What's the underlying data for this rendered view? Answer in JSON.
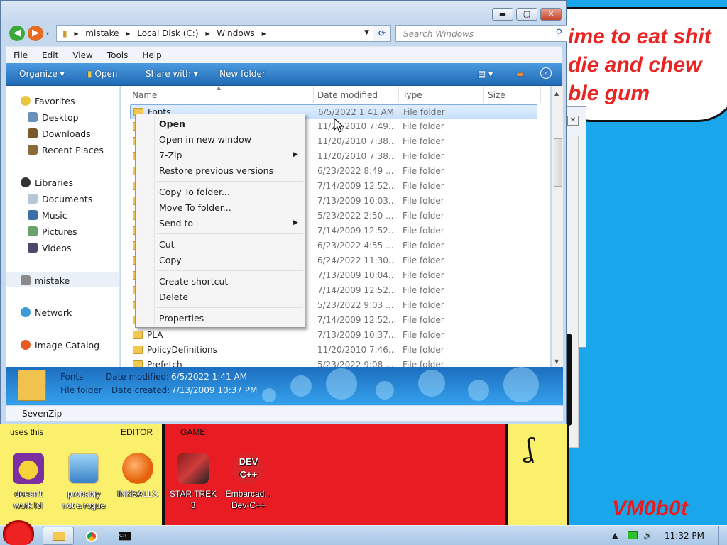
{
  "wallpaper": {
    "line1": "ime to eat shit",
    "line2": "die and chew",
    "line3": "ble gum",
    "label_uses": "uses this",
    "label_editor": "EDITOR",
    "label_game": "GAME",
    "signature": "VM0b0t"
  },
  "window": {
    "address": [
      "mistake",
      "Local Disk (C:)",
      "Windows"
    ],
    "search_placeholder": "Search Windows",
    "menu": [
      "File",
      "Edit",
      "View",
      "Tools",
      "Help"
    ],
    "toolbar": {
      "organize": "Organize",
      "open": "Open",
      "share_with": "Share with",
      "new_folder": "New folder"
    },
    "nav": {
      "favorites": "Favorites",
      "desktop": "Desktop",
      "downloads": "Downloads",
      "recent_places": "Recent Places",
      "libraries": "Libraries",
      "documents": "Documents",
      "music": "Music",
      "pictures": "Pictures",
      "videos": "Videos",
      "mistake": "mistake",
      "network": "Network",
      "image_catalog": "Image Catalog"
    },
    "columns": {
      "name": "Name",
      "date_modified": "Date modified",
      "type": "Type",
      "size": "Size"
    },
    "rows": [
      {
        "name": "Fonts",
        "date": "6/5/2022 1:41 AM",
        "type": "File folder"
      },
      {
        "name": "",
        "date": "11/20/2010 7:49...",
        "type": "File folder"
      },
      {
        "name": "",
        "date": "11/20/2010 7:38...",
        "type": "File folder"
      },
      {
        "name": "",
        "date": "11/20/2010 7:38...",
        "type": "File folder"
      },
      {
        "name": "",
        "date": "6/23/2022 8:49 ...",
        "type": "File folder"
      },
      {
        "name": "",
        "date": "7/14/2009 12:52...",
        "type": "File folder"
      },
      {
        "name": "",
        "date": "7/13/2009 10:03...",
        "type": "File folder"
      },
      {
        "name": "",
        "date": "5/23/2022 2:50 ...",
        "type": "File folder"
      },
      {
        "name": "",
        "date": "7/14/2009 12:52...",
        "type": "File folder"
      },
      {
        "name": "",
        "date": "6/23/2022 4:55 ...",
        "type": "File folder"
      },
      {
        "name": "",
        "date": "6/24/2022 11:30...",
        "type": "File folder"
      },
      {
        "name": "",
        "date": "7/13/2009 10:04...",
        "type": "File folder"
      },
      {
        "name": "",
        "date": "7/14/2009 12:52...",
        "type": "File folder"
      },
      {
        "name": "",
        "date": "5/23/2022 9:03 ...",
        "type": "File folder"
      },
      {
        "name": "",
        "date": "7/14/2009 12:52...",
        "type": "File folder"
      },
      {
        "name": "PLA",
        "date": "7/13/2009 10:37...",
        "type": "File folder"
      },
      {
        "name": "PolicyDefinitions",
        "date": "11/20/2010 7:46...",
        "type": "File folder"
      },
      {
        "name": "Prefetch",
        "date": "5/23/2022 9:08 ...",
        "type": "File folder"
      }
    ],
    "details": {
      "name": "Fonts",
      "kind": "File folder",
      "modified_label": "Date modified:",
      "modified_value": "6/5/2022 1:41 AM",
      "created_label": "Date created:",
      "created_value": "7/13/2009 10:37 PM"
    },
    "status": "SevenZip"
  },
  "context_menu": {
    "open": "Open",
    "open_new_window": "Open in new window",
    "seven_zip": "7-Zip",
    "restore": "Restore previous versions",
    "copy_to": "Copy To folder...",
    "move_to": "Move To folder...",
    "send_to": "Send to",
    "cut": "Cut",
    "copy": "Copy",
    "create_shortcut": "Create shortcut",
    "delete": "Delete",
    "properties": "Properties"
  },
  "desktop_icons": [
    {
      "line1": "doesn't",
      "line2": "work lol"
    },
    {
      "line1": "probably",
      "line2": "not a rogue"
    },
    {
      "line1": "INKBALLS",
      "line2": ""
    },
    {
      "line1": "STAR TREK",
      "line2": "3"
    },
    {
      "line1": "Embarcad...",
      "line2": "Dev-C++"
    }
  ],
  "taskbar": {
    "clock": "11:32 PM"
  },
  "colors": {
    "desktop_blue": "#1aa6ea",
    "wallpaper_red": "#e91b23",
    "wallpaper_yellow": "#fbf06b",
    "toolbar_blue": "#1f6bb6",
    "selection": "#c7e0fc"
  }
}
